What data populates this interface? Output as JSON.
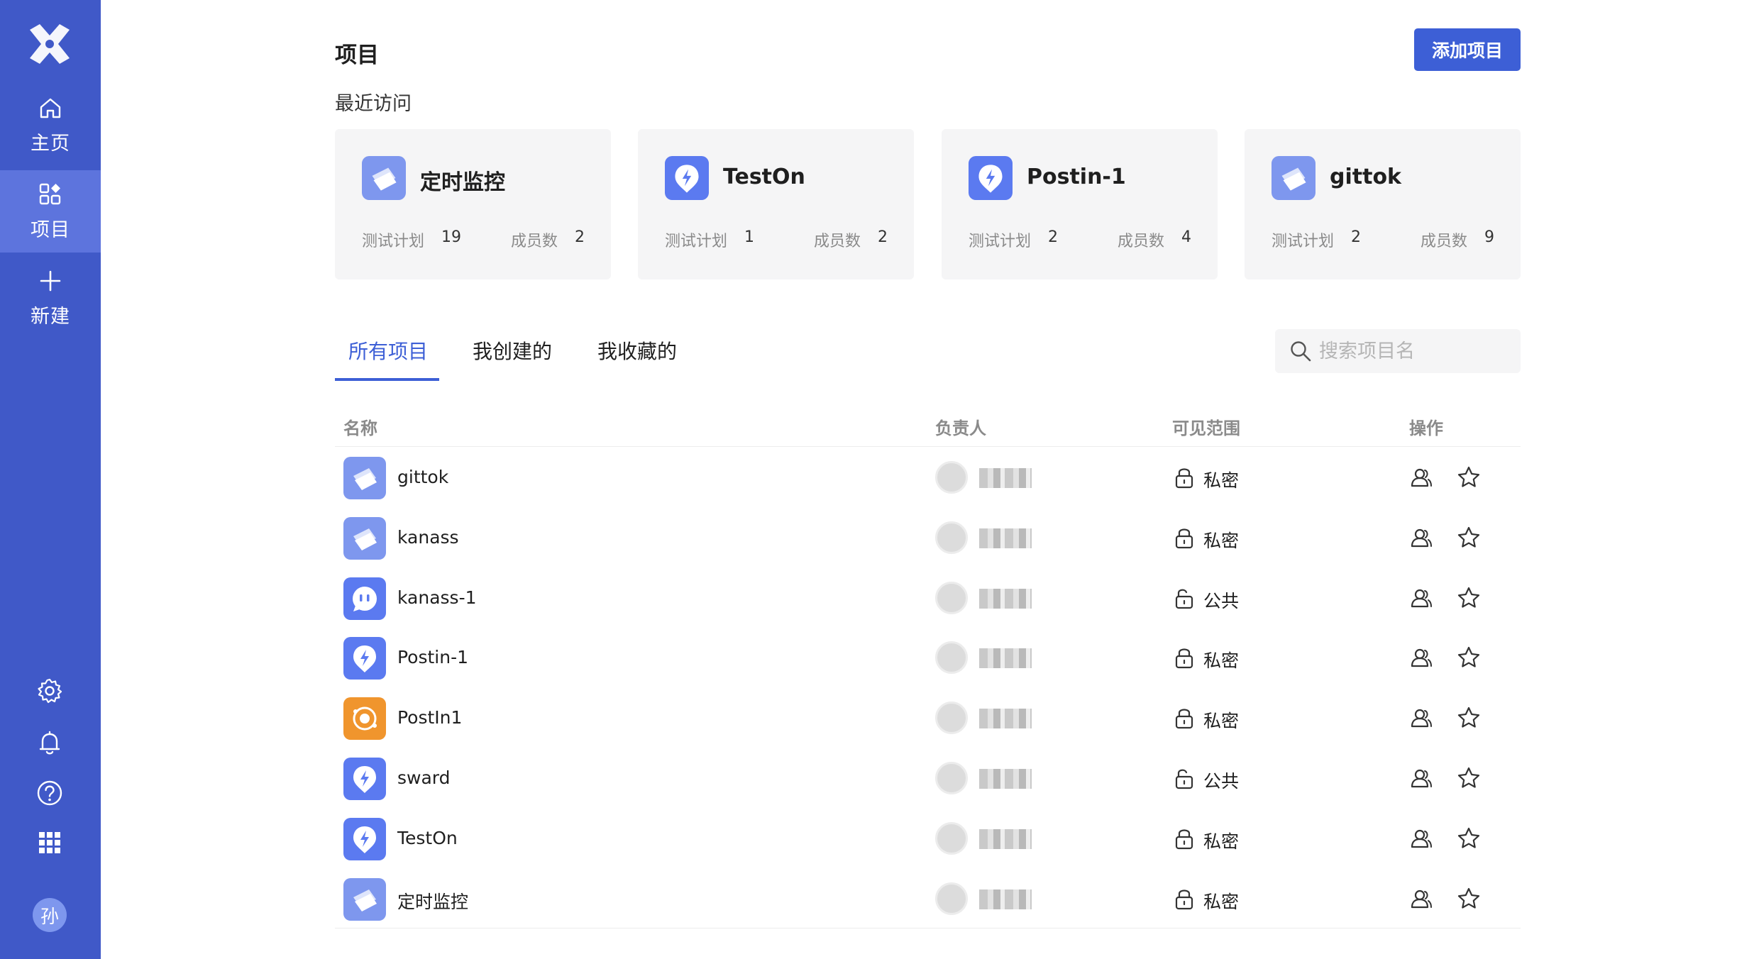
{
  "sidebar": {
    "items": [
      {
        "label": "主页",
        "icon": "home-icon"
      },
      {
        "label": "项目",
        "icon": "project-grid-icon",
        "active": true
      },
      {
        "label": "新建",
        "icon": "plus-icon"
      }
    ],
    "bottom_icons": [
      "settings-icon",
      "bell-icon",
      "help-icon",
      "apps-grid-icon"
    ],
    "avatar_text": "孙"
  },
  "header": {
    "title": "项目",
    "add_button": "添加项目"
  },
  "recent": {
    "title": "最近访问",
    "stat_plan_label": "测试计划",
    "stat_member_label": "成员数",
    "cards": [
      {
        "name": "定时监控",
        "plans": "19",
        "members": "2",
        "icon": "cards-icon",
        "color": "#7e97ee"
      },
      {
        "name": "TestOn",
        "plans": "1",
        "members": "2",
        "icon": "bolt-icon",
        "color": "#5b7af0"
      },
      {
        "name": "Postin-1",
        "plans": "2",
        "members": "4",
        "icon": "bolt-icon",
        "color": "#5b7af0"
      },
      {
        "name": "gittok",
        "plans": "2",
        "members": "9",
        "icon": "cards-icon",
        "color": "#7e97ee"
      }
    ]
  },
  "tabs": [
    {
      "label": "所有项目",
      "active": true
    },
    {
      "label": "我创建的"
    },
    {
      "label": "我收藏的"
    }
  ],
  "search": {
    "placeholder": "搜索项目名"
  },
  "table": {
    "columns": [
      "名称",
      "负责人",
      "可见范围",
      "操作"
    ],
    "rows": [
      {
        "name": "gittok",
        "visibility": "私密",
        "icon": "cards-icon",
        "color": "#7e97ee"
      },
      {
        "name": "kanass",
        "visibility": "私密",
        "icon": "cards-icon",
        "color": "#7e97ee"
      },
      {
        "name": "kanass-1",
        "visibility": "公共",
        "icon": "chat-face-icon",
        "color": "#5b7af0"
      },
      {
        "name": "Postin-1",
        "visibility": "私密",
        "icon": "bolt-icon",
        "color": "#5b7af0"
      },
      {
        "name": "PostIn1",
        "visibility": "私密",
        "icon": "orbit-icon",
        "color": "#f0952d"
      },
      {
        "name": "sward",
        "visibility": "公共",
        "icon": "bolt-icon",
        "color": "#5b7af0"
      },
      {
        "name": "TestOn",
        "visibility": "私密",
        "icon": "bolt-icon",
        "color": "#5b7af0"
      },
      {
        "name": "定时监控",
        "visibility": "私密",
        "icon": "cards-icon",
        "color": "#7e97ee"
      }
    ]
  }
}
